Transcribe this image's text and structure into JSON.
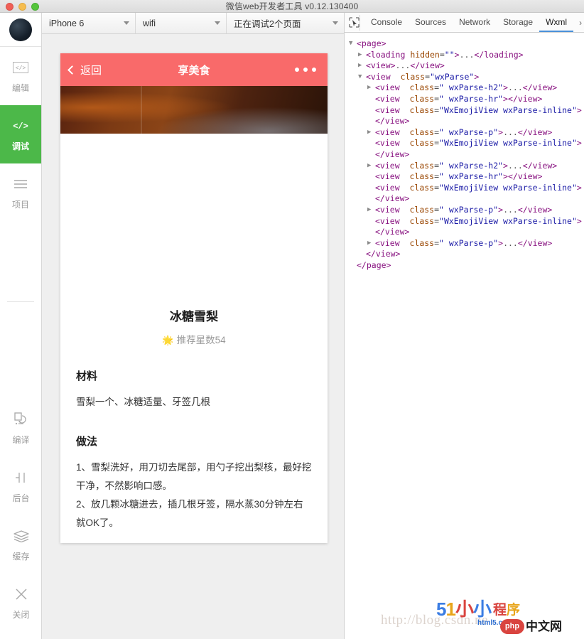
{
  "window": {
    "title": "微信web开发者工具 v0.12.130400",
    "traffic_lights": [
      "close",
      "minimize",
      "zoom"
    ]
  },
  "rail": {
    "avatar": "user-avatar",
    "items": [
      {
        "label": "编辑",
        "icon": "code-brackets-icon",
        "active": false
      },
      {
        "label": "调试",
        "icon": "code-brackets-icon",
        "active": true
      },
      {
        "label": "项目",
        "icon": "list-lines-icon",
        "active": false
      }
    ],
    "bottom_items": [
      {
        "label": "编译",
        "icon": "compile-refresh-icon"
      },
      {
        "label": "后台",
        "icon": "background-toggle-icon"
      },
      {
        "label": "缓存",
        "icon": "layers-cache-icon"
      },
      {
        "label": "关闭",
        "icon": "close-x-icon"
      }
    ]
  },
  "sim_toolbar": {
    "device": "iPhone 6",
    "network": "wifi",
    "debug_status": "正在调试2个页面"
  },
  "phone": {
    "navbar": {
      "back_label": "返回",
      "title": "享美食",
      "menu": "more-dots-icon"
    },
    "hero_image": "food-photo-banner",
    "recipe": {
      "title": "冰糖雪梨",
      "star_icon": "★",
      "rating_text": "推荐星数54",
      "sections": [
        {
          "heading": "材料",
          "body": [
            "雪梨一个、冰糖适量、牙签几根"
          ]
        },
        {
          "heading": "做法",
          "body": [
            "1、雪梨洗好，用刀切去尾部，用勺子挖出梨核，最好挖干净，不然影响口感。",
            "2、放几颗冰糖进去，插几根牙签，隔水蒸30分钟左右就OK了。"
          ]
        }
      ]
    }
  },
  "devtools": {
    "inspect_icon": "inspect-cursor-icon",
    "tabs": [
      {
        "label": "Console",
        "active": false
      },
      {
        "label": "Sources",
        "active": false
      },
      {
        "label": "Network",
        "active": false
      },
      {
        "label": "Storage",
        "active": false
      },
      {
        "label": "Wxml",
        "active": true
      }
    ],
    "overflow": "›",
    "dom_lines": [
      {
        "indent": 0,
        "twisty": "open",
        "parts": [
          {
            "t": "tag",
            "v": "<page>"
          }
        ]
      },
      {
        "indent": 1,
        "twisty": "closed",
        "parts": [
          {
            "t": "tag",
            "v": "<loading"
          },
          {
            "t": "attr",
            "v": " hidden"
          },
          {
            "t": "txt",
            "v": "="
          },
          {
            "t": "val",
            "v": "\"\""
          },
          {
            "t": "tag",
            "v": ">"
          },
          {
            "t": "txt",
            "v": "..."
          },
          {
            "t": "tag",
            "v": "</loading>"
          }
        ]
      },
      {
        "indent": 1,
        "twisty": "closed",
        "parts": [
          {
            "t": "tag",
            "v": "<view>"
          },
          {
            "t": "txt",
            "v": "..."
          },
          {
            "t": "tag",
            "v": "</view>"
          }
        ]
      },
      {
        "indent": 1,
        "twisty": "open",
        "parts": [
          {
            "t": "tag",
            "v": "<view"
          },
          {
            "t": "attr",
            "v": "  class"
          },
          {
            "t": "txt",
            "v": "="
          },
          {
            "t": "val",
            "v": "\"wxParse\""
          },
          {
            "t": "tag",
            "v": ">"
          }
        ]
      },
      {
        "indent": 2,
        "twisty": "closed",
        "parts": [
          {
            "t": "tag",
            "v": "<view"
          },
          {
            "t": "attr",
            "v": "  class"
          },
          {
            "t": "txt",
            "v": "="
          },
          {
            "t": "val",
            "v": "\" wxParse-h2\""
          },
          {
            "t": "tag",
            "v": ">"
          },
          {
            "t": "txt",
            "v": "..."
          },
          {
            "t": "tag",
            "v": "</view>"
          }
        ]
      },
      {
        "indent": 2,
        "twisty": "none",
        "parts": [
          {
            "t": "tag",
            "v": "<view"
          },
          {
            "t": "attr",
            "v": "  class"
          },
          {
            "t": "txt",
            "v": "="
          },
          {
            "t": "val",
            "v": "\" wxParse-hr\""
          },
          {
            "t": "tag",
            "v": ">"
          },
          {
            "t": "tag",
            "v": "</view>"
          }
        ]
      },
      {
        "indent": 2,
        "twisty": "none",
        "parts": [
          {
            "t": "tag",
            "v": "<view"
          },
          {
            "t": "attr",
            "v": "  class"
          },
          {
            "t": "txt",
            "v": "="
          },
          {
            "t": "val",
            "v": "\"WxEmojiView wxParse-inline\""
          },
          {
            "t": "tag",
            "v": ">"
          }
        ]
      },
      {
        "indent": 2,
        "twisty": "none",
        "parts": [
          {
            "t": "tag",
            "v": "</view>"
          }
        ]
      },
      {
        "indent": 2,
        "twisty": "closed",
        "parts": [
          {
            "t": "tag",
            "v": "<view"
          },
          {
            "t": "attr",
            "v": "  class"
          },
          {
            "t": "txt",
            "v": "="
          },
          {
            "t": "val",
            "v": "\" wxParse-p\""
          },
          {
            "t": "tag",
            "v": ">"
          },
          {
            "t": "txt",
            "v": "..."
          },
          {
            "t": "tag",
            "v": "</view>"
          }
        ]
      },
      {
        "indent": 2,
        "twisty": "none",
        "parts": [
          {
            "t": "tag",
            "v": "<view"
          },
          {
            "t": "attr",
            "v": "  class"
          },
          {
            "t": "txt",
            "v": "="
          },
          {
            "t": "val",
            "v": "\"WxEmojiView wxParse-inline\""
          },
          {
            "t": "tag",
            "v": ">"
          }
        ]
      },
      {
        "indent": 2,
        "twisty": "none",
        "parts": [
          {
            "t": "tag",
            "v": "</view>"
          }
        ]
      },
      {
        "indent": 2,
        "twisty": "closed",
        "parts": [
          {
            "t": "tag",
            "v": "<view"
          },
          {
            "t": "attr",
            "v": "  class"
          },
          {
            "t": "txt",
            "v": "="
          },
          {
            "t": "val",
            "v": "\" wxParse-h2\""
          },
          {
            "t": "tag",
            "v": ">"
          },
          {
            "t": "txt",
            "v": "..."
          },
          {
            "t": "tag",
            "v": "</view>"
          }
        ]
      },
      {
        "indent": 2,
        "twisty": "none",
        "parts": [
          {
            "t": "tag",
            "v": "<view"
          },
          {
            "t": "attr",
            "v": "  class"
          },
          {
            "t": "txt",
            "v": "="
          },
          {
            "t": "val",
            "v": "\" wxParse-hr\""
          },
          {
            "t": "tag",
            "v": ">"
          },
          {
            "t": "tag",
            "v": "</view>"
          }
        ]
      },
      {
        "indent": 2,
        "twisty": "none",
        "parts": [
          {
            "t": "tag",
            "v": "<view"
          },
          {
            "t": "attr",
            "v": "  class"
          },
          {
            "t": "txt",
            "v": "="
          },
          {
            "t": "val",
            "v": "\"WxEmojiView wxParse-inline\""
          },
          {
            "t": "tag",
            "v": ">"
          }
        ]
      },
      {
        "indent": 2,
        "twisty": "none",
        "parts": [
          {
            "t": "tag",
            "v": "</view>"
          }
        ]
      },
      {
        "indent": 2,
        "twisty": "closed",
        "parts": [
          {
            "t": "tag",
            "v": "<view"
          },
          {
            "t": "attr",
            "v": "  class"
          },
          {
            "t": "txt",
            "v": "="
          },
          {
            "t": "val",
            "v": "\" wxParse-p\""
          },
          {
            "t": "tag",
            "v": ">"
          },
          {
            "t": "txt",
            "v": "..."
          },
          {
            "t": "tag",
            "v": "</view>"
          }
        ]
      },
      {
        "indent": 2,
        "twisty": "none",
        "parts": [
          {
            "t": "tag",
            "v": "<view"
          },
          {
            "t": "attr",
            "v": "  class"
          },
          {
            "t": "txt",
            "v": "="
          },
          {
            "t": "val",
            "v": "\"WxEmojiView wxParse-inline\""
          },
          {
            "t": "tag",
            "v": ">"
          }
        ]
      },
      {
        "indent": 2,
        "twisty": "none",
        "parts": [
          {
            "t": "tag",
            "v": "</view>"
          }
        ]
      },
      {
        "indent": 2,
        "twisty": "closed",
        "parts": [
          {
            "t": "tag",
            "v": "<view"
          },
          {
            "t": "attr",
            "v": "  class"
          },
          {
            "t": "txt",
            "v": "="
          },
          {
            "t": "val",
            "v": "\" wxParse-p\""
          },
          {
            "t": "tag",
            "v": ">"
          },
          {
            "t": "txt",
            "v": "..."
          },
          {
            "t": "tag",
            "v": "</view>"
          }
        ]
      },
      {
        "indent": 1,
        "twisty": "none",
        "parts": [
          {
            "t": "tag",
            "v": "</view>"
          }
        ]
      },
      {
        "indent": 0,
        "twisty": "none",
        "parts": [
          {
            "t": "tag",
            "v": "</page>"
          }
        ]
      }
    ]
  },
  "watermarks": {
    "url": "http://blog.csdn.ne",
    "logo_51": [
      "5",
      "1",
      "小",
      "小"
    ],
    "logo_cx": [
      "程",
      "序"
    ],
    "html5": "html5.com",
    "php": "php",
    "zhongwen": "中文网"
  },
  "colors": {
    "accent_red": "#f96a6a",
    "active_green": "#4cb849",
    "tab_underline": "#4a90d9"
  }
}
